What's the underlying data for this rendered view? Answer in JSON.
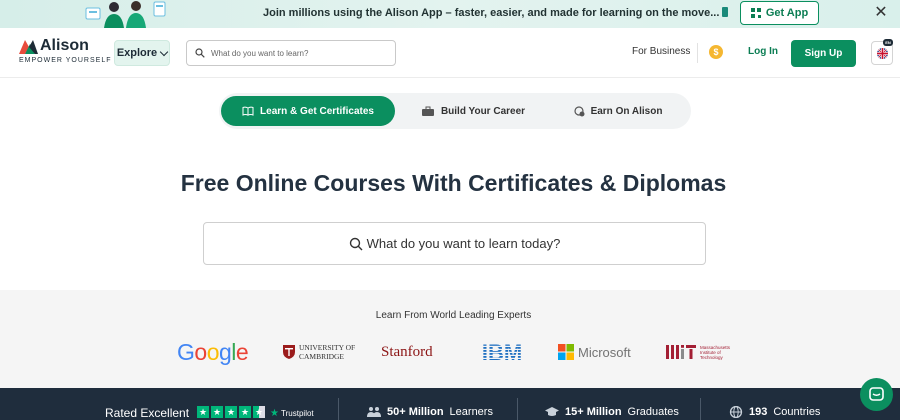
{
  "promo": {
    "text": "Join millions using the Alison App – faster, easier, and made for learning on the move...",
    "get_app_label": "Get App",
    "close_label": "✕"
  },
  "header": {
    "logo_name": "Alison",
    "logo_tagline": "EMPOWER YOURSELF",
    "explore_label": "Explore",
    "search_placeholder": "What do you want to learn?",
    "for_business_label": "For Business",
    "coin_symbol": "$",
    "login_label": "Log In",
    "signup_label": "Sign Up",
    "language_badge": "EN"
  },
  "tabs": [
    {
      "label": "Learn & Get Certificates",
      "active": true
    },
    {
      "label": "Build Your Career",
      "active": false
    },
    {
      "label": "Earn On Alison",
      "active": false
    }
  ],
  "hero": {
    "title": "Free Online Courses With Certificates & Diplomas",
    "search_text": "What do you want to learn today?"
  },
  "experts": {
    "title": "Learn From World Leading Experts",
    "partners": {
      "google": "Google",
      "cambridge_line1": "UNIVERSITY OF",
      "cambridge_line2": "CAMBRIDGE",
      "stanford": "Stanford",
      "ibm": "IBM",
      "microsoft": "Microsoft",
      "mit_line1": "Massachusetts",
      "mit_line2": "Institute of",
      "mit_line3": "Technology"
    }
  },
  "stats": {
    "rated_label": "Rated Excellent",
    "trustpilot_label": "Trustpilot",
    "learners_value": "50+ Million",
    "learners_label": "Learners",
    "graduates_value": "15+ Million",
    "graduates_label": "Graduates",
    "countries_value": "193",
    "countries_label": "Countries"
  },
  "colors": {
    "brand_green": "#0b8f5f",
    "dark_navy": "#1f2d3d",
    "promo_bg": "#e3f3ef"
  }
}
